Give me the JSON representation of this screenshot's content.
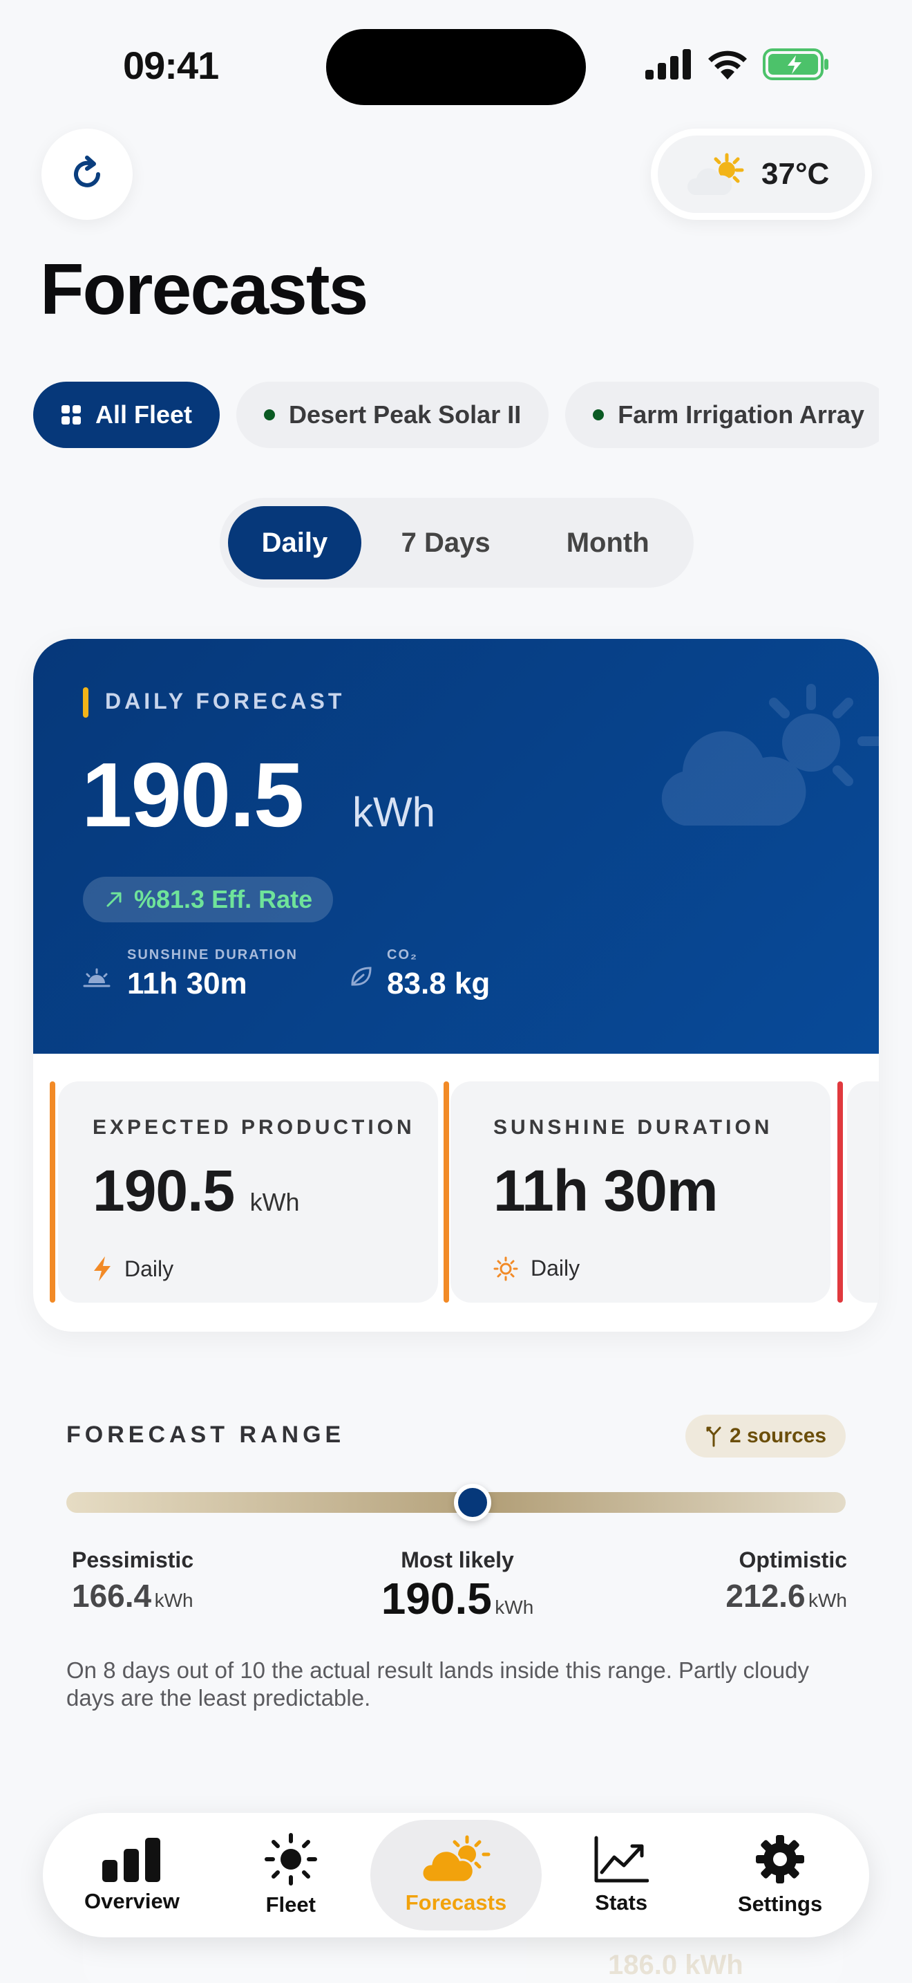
{
  "status_bar": {
    "time": "09:41"
  },
  "weather": {
    "temperature": "37°C",
    "icon": "partly-sunny-icon"
  },
  "page": {
    "title": "Forecasts"
  },
  "fleet_chips": [
    {
      "label": "All Fleet",
      "icon": "grid-icon",
      "active": true
    },
    {
      "label": "Desert Peak Solar II",
      "active": false
    },
    {
      "label": "Farm Irrigation Array",
      "active": false
    }
  ],
  "periods": [
    {
      "label": "Daily",
      "active": true
    },
    {
      "label": "7 Days",
      "active": false
    },
    {
      "label": "Month",
      "active": false
    }
  ],
  "hero": {
    "label": "DAILY FORECAST",
    "value": "190.5",
    "unit": "kWh",
    "efficiency": "%81.3 Eff. Rate",
    "sunshine_label": "SUNSHINE DURATION",
    "sunshine_value": "11h 30m",
    "co2_label": "CO₂",
    "co2_value": "83.8 kg"
  },
  "mini_cards": [
    {
      "label": "EXPECTED PRODUCTION",
      "value": "190.5",
      "unit": "kWh",
      "period": "Daily",
      "icon": "bolt-icon",
      "accent": "#f28a26"
    },
    {
      "label": "SUNSHINE DURATION",
      "value": "11h 30m",
      "unit": "",
      "period": "Daily",
      "icon": "sun-icon",
      "accent": "#f28a26"
    }
  ],
  "forecast_range": {
    "title": "FORECAST RANGE",
    "sources": "2 sources",
    "pessimistic_label": "Pessimistic",
    "pessimistic_value": "166.4",
    "likely_label": "Most likely",
    "likely_value": "190.5",
    "optimistic_label": "Optimistic",
    "optimistic_value": "212.6",
    "unit": "kWh",
    "note": "On 8 days out of 10 the actual result lands inside this range. Partly cloudy days are the least predictable."
  },
  "ghost": {
    "value": "186.0 kWh"
  },
  "tabs": [
    {
      "label": "Overview",
      "icon": "bar-chart-icon",
      "active": false
    },
    {
      "label": "Fleet",
      "icon": "sun-icon",
      "active": false
    },
    {
      "label": "Forecasts",
      "icon": "cloud-sun-icon",
      "active": true
    },
    {
      "label": "Stats",
      "icon": "line-chart-icon",
      "active": false
    },
    {
      "label": "Settings",
      "icon": "gear-icon",
      "active": false
    }
  ],
  "colors": {
    "primary": "#06387a",
    "accent": "#f2a20c",
    "positive": "#6fe39a",
    "warning": "#f28a26",
    "danger": "#e0393e"
  }
}
